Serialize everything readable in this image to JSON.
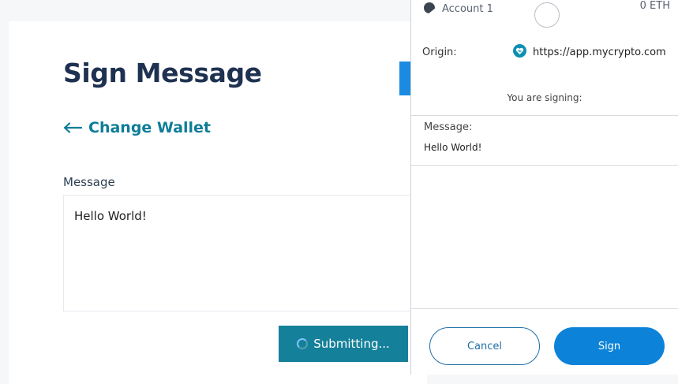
{
  "page": {
    "title": "Sign Message",
    "change_wallet_label": "Change Wallet",
    "message_label": "Message",
    "message_value": "Hello World!",
    "submit_label": "Submitting..."
  },
  "popup": {
    "account_name": "Account 1",
    "balance": "0 ETH",
    "origin_label": "Origin:",
    "origin_url": "https://app.mycrypto.com",
    "signing_text": "You are signing:",
    "message_label": "Message:",
    "message_text": "Hello World!",
    "cancel_label": "Cancel",
    "sign_label": "Sign"
  },
  "colors": {
    "title": "#1f3150",
    "teal": "#0e7d98",
    "submit_bg": "#15809a",
    "sign_bg": "#0c83d8",
    "cancel_border": "#1d6fa8"
  },
  "icons": {
    "back_arrow": "arrow-left-icon",
    "account": "account-identicon",
    "origin": "mycrypto-heart-icon",
    "spinner": "loading-spinner-icon"
  }
}
